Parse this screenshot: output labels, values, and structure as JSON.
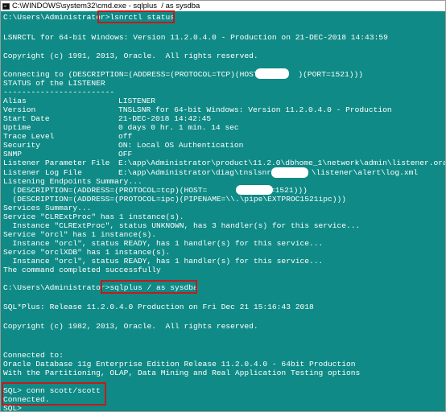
{
  "window": {
    "title": "C:\\WINDOWS\\system32\\cmd.exe - sqlplus  / as sysdba",
    "icon": "cmd-icon"
  },
  "console": {
    "cmd1": {
      "prompt": "C:\\Users\\Administrator>",
      "command": "lsnrctl status"
    },
    "lsnrctl_banner": "LSNRCTL for 64-bit Windows: Version 11.2.0.4.0 - Production on 21-DEC-2018 14:43:59",
    "copyright1": "Copyright (c) 1991, 2013, Oracle.  All rights reserved.",
    "connecting_a": "Connecting to (DESCRIPTION=(ADDRESS=(PROTOCOL=TCP)(HOST=",
    "connecting_b": ")(PORT=1521)))",
    "status_header": "STATUS of the LISTENER",
    "divider": "------------------------",
    "status_rows": [
      {
        "key": "Alias",
        "value": "LISTENER"
      },
      {
        "key": "Version",
        "value": "TNSLSNR for 64-bit Windows: Version 11.2.0.4.0 - Production"
      },
      {
        "key": "Start Date",
        "value": "21-DEC-2018 14:42:45"
      },
      {
        "key": "Uptime",
        "value": "0 days 0 hr. 1 min. 14 sec"
      },
      {
        "key": "Trace Level",
        "value": "off"
      },
      {
        "key": "Security",
        "value": "ON: Local OS Authentication"
      },
      {
        "key": "SNMP",
        "value": "OFF"
      },
      {
        "key": "Listener Parameter File",
        "value": "E:\\app\\Administrator\\product\\11.2.0\\dbhome_1\\network\\admin\\listener.ora"
      }
    ],
    "log_file_key": "Listener Log File",
    "log_file_a": "E:\\app\\Administrator\\diag\\tnslsnr\\",
    "log_file_b": "\\listener\\alert\\log.xml",
    "endpoints_header": "Listening Endpoints Summary...",
    "endpoint1_a": "  (DESCRIPTION=(ADDRESS=(PROTOCOL=tcp)(HOST=",
    "endpoint1_b": ")(PORT=1521)))",
    "endpoint2": "  (DESCRIPTION=(ADDRESS=(PROTOCOL=ipc)(PIPENAME=\\\\.\\pipe\\EXTPROC1521ipc)))",
    "services_lines": [
      "Services Summary...",
      "Service \"CLRExtProc\" has 1 instance(s).",
      "  Instance \"CLRExtProc\", status UNKNOWN, has 3 handler(s) for this service...",
      "Service \"orcl\" has 1 instance(s).",
      "  Instance \"orcl\", status READY, has 1 handler(s) for this service...",
      "Service \"orclXDB\" has 1 instance(s).",
      "  Instance \"orcl\", status READY, has 1 handler(s) for this service...",
      "The command completed successfully"
    ],
    "cmd2": {
      "prompt": "C:\\Users\\Administrator>",
      "command": "sqlplus / as sysdba"
    },
    "sqlplus_banner": "SQL*Plus: Release 11.2.0.4.0 Production on Fri Dec 21 15:16:43 2018",
    "copyright2": "Copyright (c) 1982, 2013, Oracle.  All rights reserved.",
    "connected_lines": [
      "Connected to:",
      "Oracle Database 11g Enterprise Edition Release 11.2.0.4.0 - 64bit Production",
      "With the Partitioning, OLAP, Data Mining and Real Application Testing options"
    ],
    "sql_cmd": "SQL> conn scott/scott",
    "connected": "Connected.",
    "sql_prompt": "SQL>"
  }
}
